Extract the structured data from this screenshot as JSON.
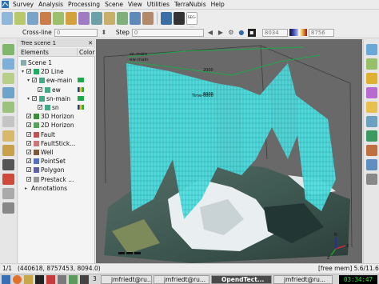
{
  "menu": {
    "items": [
      "Survey",
      "Analysis",
      "Processing",
      "Scene",
      "View",
      "Utilities",
      "TerraNubis",
      "Help"
    ]
  },
  "slice_bar": {
    "crossline_label": "Cross-line",
    "crossline_value": "0",
    "step_label": "Step",
    "step_value": "0",
    "field_1": "8034",
    "field_2": "8756",
    "icon_label": "SEG-Y"
  },
  "tree": {
    "panel_title": "Tree scene 1",
    "col_elements": "Elements",
    "col_color": "Color",
    "items": [
      {
        "label": "Scene 1",
        "indent": 0,
        "check": false,
        "expand": false,
        "icon": "scene"
      },
      {
        "label": "2D Line",
        "indent": 1,
        "check": true,
        "expand": true,
        "icon": "line2d"
      },
      {
        "label": "ew-main",
        "indent": 2,
        "check": true,
        "expand": true,
        "icon": "line",
        "swatch": "green"
      },
      {
        "label": "ew",
        "indent": 3,
        "check": true,
        "expand": false,
        "icon": "line",
        "swatch": "multi"
      },
      {
        "label": "sn-main",
        "indent": 2,
        "check": true,
        "expand": true,
        "icon": "line",
        "swatch": "green"
      },
      {
        "label": "sn",
        "indent": 3,
        "check": true,
        "expand": false,
        "icon": "line",
        "swatch": "multi"
      },
      {
        "label": "3D Horizon",
        "indent": 1,
        "check": true,
        "expand": false,
        "icon": "horizon"
      },
      {
        "label": "2D Horizon",
        "indent": 1,
        "check": true,
        "expand": false,
        "icon": "horizon2d"
      },
      {
        "label": "Fault",
        "indent": 1,
        "check": true,
        "expand": false,
        "icon": "fault"
      },
      {
        "label": "FaultStick...",
        "indent": 1,
        "check": true,
        "expand": false,
        "icon": "faultstick"
      },
      {
        "label": "Well",
        "indent": 1,
        "check": true,
        "expand": false,
        "icon": "well"
      },
      {
        "label": "PointSet",
        "indent": 1,
        "check": true,
        "expand": false,
        "icon": "pointset"
      },
      {
        "label": "Polygon",
        "indent": 1,
        "check": true,
        "expand": false,
        "icon": "polygon"
      },
      {
        "label": "Prestack ...",
        "indent": 1,
        "check": true,
        "expand": false,
        "icon": "prestack"
      },
      {
        "label": "Annotations",
        "indent": 1,
        "check": false,
        "expand": false,
        "icon": "none"
      }
    ]
  },
  "viewport": {
    "label_ew_main": "ew-main",
    "label_sn_main": "sn-main",
    "label_depth_2000": "2000",
    "label_depth_6000": "6000",
    "label_time": "Time-6000",
    "axis_x": "X",
    "axis_y": "N",
    "axis_z": "Z"
  },
  "status": {
    "page": "1/1",
    "coords": "(440618, 8757453, 8094.0)",
    "memory": "[free mem] 5.6/11.6 GB"
  },
  "taskbar": {
    "desktop_number": "3",
    "tasks": [
      "jmfriedt@ru...",
      "jmfriedt@ru...",
      "OpendTect...",
      "jmfriedt@ru..."
    ],
    "clock": "03:34:47 PM"
  },
  "colors": {
    "accent_cyan": "#3fd4d6",
    "line_green": "#1fa84a",
    "clock_green": "#2fe02f"
  }
}
